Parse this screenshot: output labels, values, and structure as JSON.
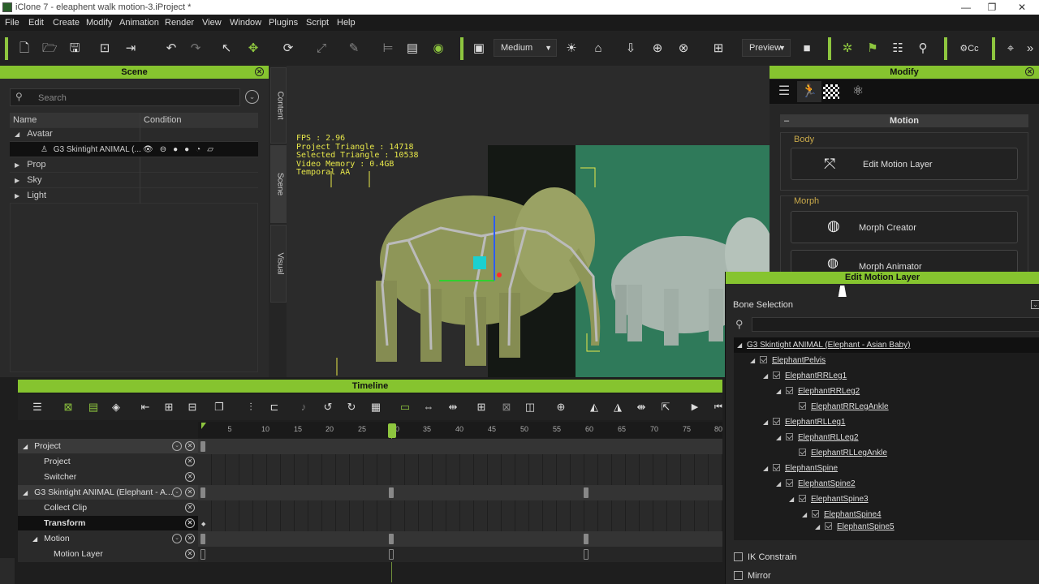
{
  "window": {
    "title": "iClone 7 - eleaphent walk motion-3.iProject *"
  },
  "menu": [
    "File",
    "Edit",
    "Create",
    "Modify",
    "Animation",
    "Render",
    "View",
    "Window",
    "Plugins",
    "Script",
    "Help"
  ],
  "toolbar": {
    "quality": "Medium",
    "render_mode": "Preview"
  },
  "scene_panel": {
    "title": "Scene",
    "search_placeholder": "Search",
    "columns": {
      "name": "Name",
      "condition": "Condition"
    },
    "tree": {
      "avatar": "Avatar",
      "avatar_child": "G3 Skintight ANIMAL (...",
      "prop": "Prop",
      "sky": "Sky",
      "light": "Light"
    }
  },
  "side_tabs": [
    "Content",
    "Scene",
    "Visual"
  ],
  "viewport": {
    "stats": "FPS : 2.96\nProject Triangle : 14718\nSelected Triangle : 10538\nVideo Memory : 0.4GB\nTemporal AA"
  },
  "modify_panel": {
    "title": "Modify",
    "section": "Motion",
    "body_label": "Body",
    "edit_motion_layer": "Edit Motion Layer",
    "morph_label": "Morph",
    "morph_creator": "Morph Creator",
    "morph_animator": "Morph Animator"
  },
  "edit_motion_layer": {
    "title": "Edit Motion Layer",
    "bone_selection": "Bone Selection",
    "root": "G3 Skintight ANIMAL (Elephant - Asian Baby)",
    "bones": [
      {
        "label": "ElephantPelvis"
      },
      {
        "label": "ElephantRRLeg1"
      },
      {
        "label": "ElephantRRLeg2"
      },
      {
        "label": "ElephantRRLegAnkle"
      },
      {
        "label": "ElephantRLLeg1"
      },
      {
        "label": "ElephantRLLeg2"
      },
      {
        "label": "ElephantRLLegAnkle"
      },
      {
        "label": "ElephantSpine"
      },
      {
        "label": "ElephantSpine2"
      },
      {
        "label": "ElephantSpine3"
      },
      {
        "label": "ElephantSpine4"
      },
      {
        "label": "ElephantSpine5"
      }
    ],
    "ik_constrain": "IK Constrain",
    "mirror": "Mirror"
  },
  "timeline": {
    "title": "Timeline",
    "ticks": [
      "5",
      "10",
      "15",
      "20",
      "25",
      "30",
      "35",
      "40",
      "45",
      "50",
      "55",
      "60",
      "65",
      "70",
      "75",
      "80"
    ],
    "current_frame": 30,
    "tracks": [
      "Project",
      "Project",
      "Switcher",
      "G3 Skintight ANIMAL (Elephant - A...",
      "Collect Clip",
      "Transform",
      "Motion",
      "Motion Layer"
    ]
  },
  "colors": {
    "accent": "#86c42f",
    "stats_text": "#e8e84a"
  }
}
